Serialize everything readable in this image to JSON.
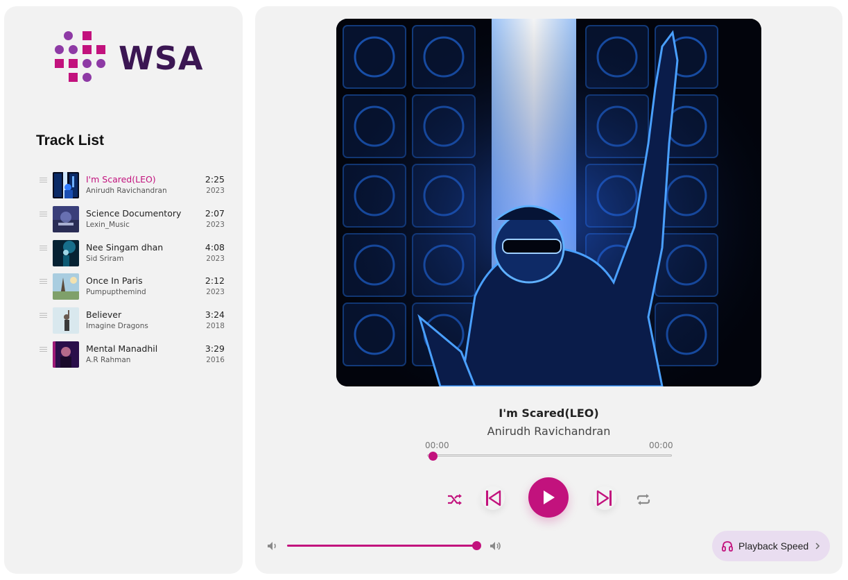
{
  "brand": {
    "logo_text": "WSA",
    "accent": "#c2127d",
    "secondary": "#8e3aa5",
    "dark": "#3b1653"
  },
  "sidebar": {
    "heading": "Track List",
    "tracks": [
      {
        "title": "I'm Scared(LEO)",
        "artist": "Anirudh Ravichandran",
        "duration": "2:25",
        "year": "2023",
        "active": true,
        "art": "blue-stage"
      },
      {
        "title": "Science Documentory",
        "artist": "Lexin_Music",
        "duration": "2:07",
        "year": "2023",
        "active": false,
        "art": "purple-lab"
      },
      {
        "title": "Nee Singam dhan",
        "artist": "Sid Sriram",
        "duration": "4:08",
        "year": "2023",
        "active": false,
        "art": "teal-concert"
      },
      {
        "title": "Once In Paris",
        "artist": "Pumpupthemind",
        "duration": "2:12",
        "year": "2023",
        "active": false,
        "art": "paris-sky"
      },
      {
        "title": "Believer",
        "artist": "Imagine Dragons",
        "duration": "3:24",
        "year": "2018",
        "active": false,
        "art": "light-figure"
      },
      {
        "title": "Mental Manadhil",
        "artist": "A.R Rahman",
        "duration": "3:29",
        "year": "2016",
        "active": false,
        "art": "neon-portrait"
      }
    ]
  },
  "player": {
    "now_title": "I'm Scared(LEO)",
    "now_artist": "Anirudh Ravichandran",
    "current_time": "00:00",
    "total_time": "00:00",
    "progress": 0.02,
    "volume": 1.0,
    "speed_label": "Playback Speed",
    "icons": {
      "shuffle": "shuffle-icon",
      "prev": "skip-previous-icon",
      "play": "play-icon",
      "next": "skip-next-icon",
      "repeat": "repeat-icon",
      "volume_low": "volume-low-icon",
      "volume_high": "volume-high-icon",
      "headphones": "headphones-icon",
      "chevron": "chevron-right-icon"
    }
  }
}
